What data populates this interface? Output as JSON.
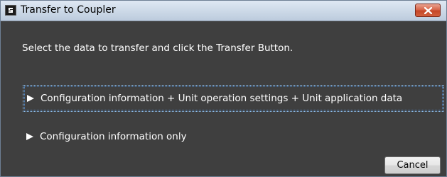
{
  "window": {
    "title": "Transfer to Coupler",
    "icon": "application-icon",
    "close_icon": "close-icon"
  },
  "dialog": {
    "instruction": "Select the data to transfer and click the Transfer Button.",
    "options": [
      {
        "label": "Configuration information + Unit operation settings + Unit application data",
        "icon": "triangle-right-icon",
        "focused": true
      },
      {
        "label": "Configuration information only",
        "icon": "triangle-right-icon",
        "focused": false
      }
    ],
    "cancel_label": "Cancel"
  },
  "colors": {
    "background": "#3f3f3f",
    "text": "#ffffff",
    "titlebar": "#cfdbe9",
    "close_button": "#c54727",
    "focus_border": "#8fc0ee"
  }
}
